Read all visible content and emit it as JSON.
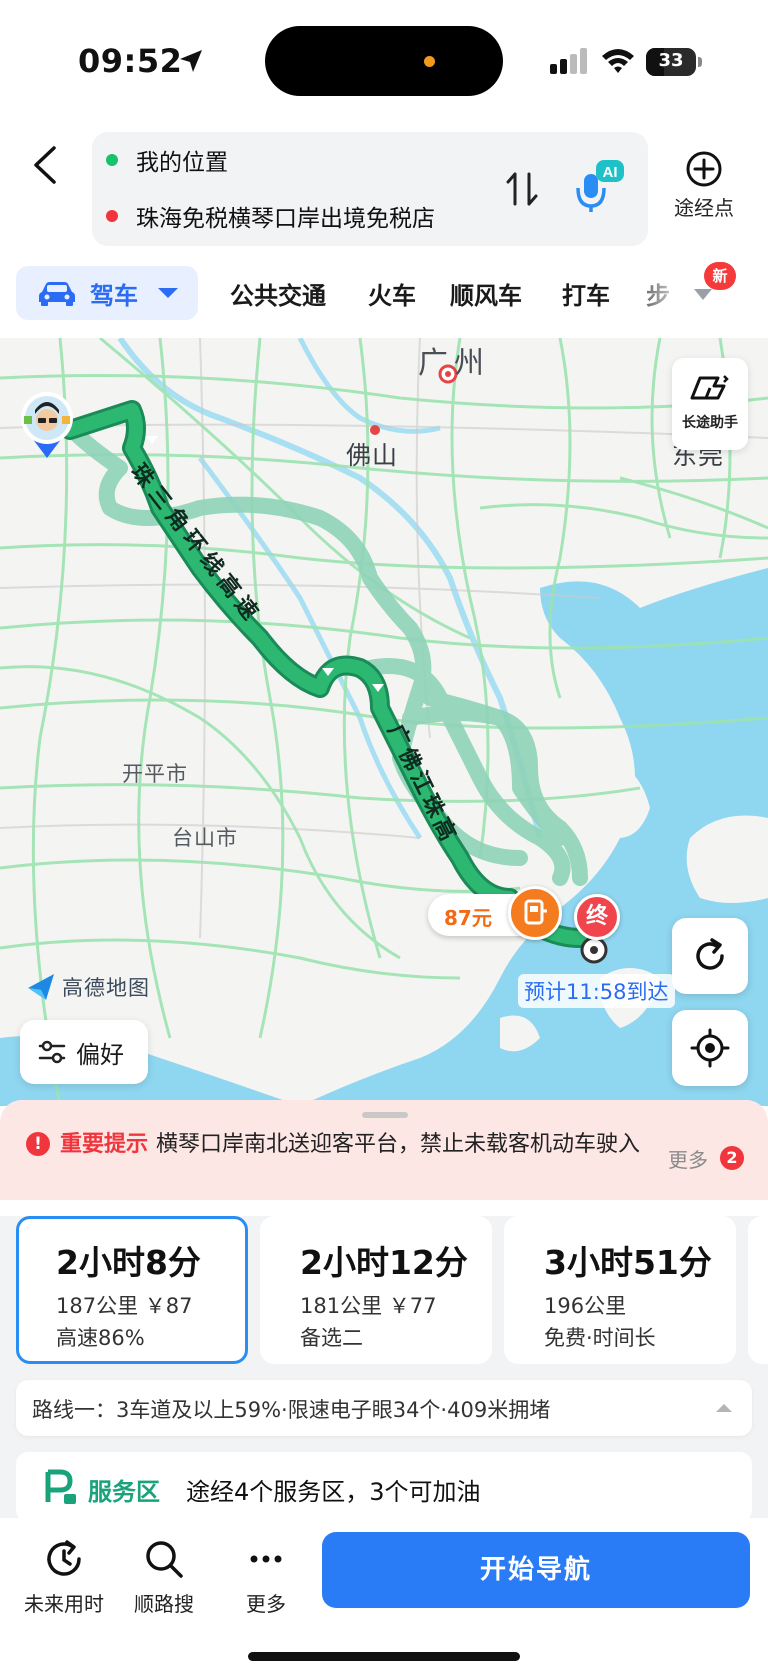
{
  "status_bar": {
    "time": "09:52",
    "battery": "33"
  },
  "route_search": {
    "origin": "我的位置",
    "destination": "珠海免税横琴口岸出境免税店",
    "waypoint_label": "途经点",
    "ai_badge": "AI"
  },
  "transport_tabs": {
    "active": "驾车",
    "items": [
      "公共交通",
      "火车",
      "顺风车",
      "打车",
      "步"
    ],
    "new_badge": "新"
  },
  "map": {
    "cities": [
      "广州",
      "佛山",
      "东莞",
      "开平市",
      "台山市"
    ],
    "road_labels": [
      "珠三角环线高速",
      "广佛江珠高"
    ],
    "long_trip_label": "长途助手",
    "logo": "高德地图",
    "preference_label": "偏好",
    "toll": "87元",
    "end_marker": "终",
    "eta": "预计11:58到达"
  },
  "notice": {
    "title": "重要提示",
    "text": "横琴口岸南北送迎客平台，禁止未载客机动车驶入",
    "more_label": "更多",
    "more_count": "2"
  },
  "routes": [
    {
      "duration": "2小时8分",
      "detail": "187公里 ￥87",
      "tag": "高速86%"
    },
    {
      "duration": "2小时12分",
      "detail": "181公里 ￥77",
      "tag": "备选二"
    },
    {
      "duration": "3小时51分",
      "detail": "196公里",
      "tag": "免费·时间长"
    }
  ],
  "route_summary": "路线一：3车道及以上59%·限速电子眼34个·409米拥堵",
  "service_area": {
    "title": "服务区",
    "text": "途经4个服务区，3个可加油"
  },
  "toolbar": {
    "items": [
      "未来用时",
      "顺路搜",
      "更多"
    ],
    "start_nav": "开始导航"
  },
  "colors": {
    "accent": "#2a7bf6",
    "route_primary": "#1fa56b",
    "route_alt": "#8fd3b8",
    "alert_red": "#f0353d",
    "toll_orange": "#f57b1f"
  }
}
